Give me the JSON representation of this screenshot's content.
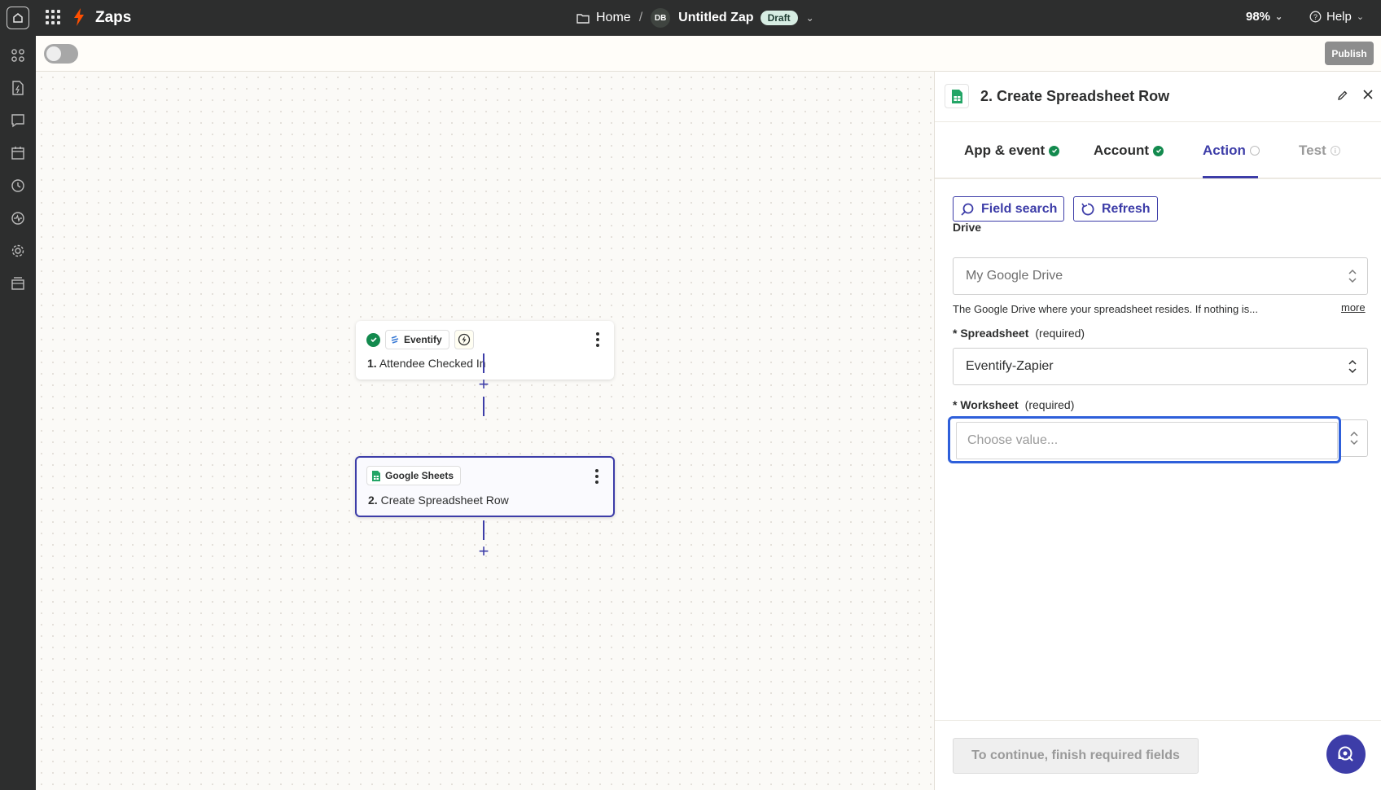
{
  "topbar": {
    "app_title": "Zaps",
    "breadcrumb_home": "Home",
    "breadcrumb_sep": "/",
    "avatar_initials": "DB",
    "zap_name": "Untitled Zap",
    "status_badge": "Draft",
    "zoom": "98%",
    "help_label": "Help"
  },
  "toolbar": {
    "publish_label": "Publish"
  },
  "canvas": {
    "steps": [
      {
        "app": "Eventify",
        "number": "1.",
        "title": "Attendee Checked In"
      },
      {
        "app": "Google Sheets",
        "number": "2.",
        "title": "Create Spreadsheet Row"
      }
    ],
    "add_step": "+"
  },
  "panel": {
    "title": "2. Create Spreadsheet Row",
    "tabs": [
      {
        "label": "App & event",
        "state": "complete"
      },
      {
        "label": "Account",
        "state": "complete"
      },
      {
        "label": "Action",
        "state": "active"
      },
      {
        "label": "Test",
        "state": "disabled"
      }
    ],
    "field_search_label": "Field search",
    "refresh_label": "Refresh",
    "drive": {
      "label": "Drive",
      "value": "My Google Drive",
      "help": "The Google Drive where your spreadsheet resides. If nothing is...",
      "more": "more"
    },
    "spreadsheet": {
      "label": "* Spreadsheet",
      "required": "(required)",
      "value": "Eventify-Zapier"
    },
    "worksheet": {
      "label": "* Worksheet",
      "required": "(required)",
      "placeholder": "Choose value..."
    },
    "continue_label": "To continue, finish required fields"
  },
  "colors": {
    "accent": "#3d3da8",
    "focus": "#2e5fda",
    "success": "#138a4e",
    "brand": "#ff4f00"
  }
}
